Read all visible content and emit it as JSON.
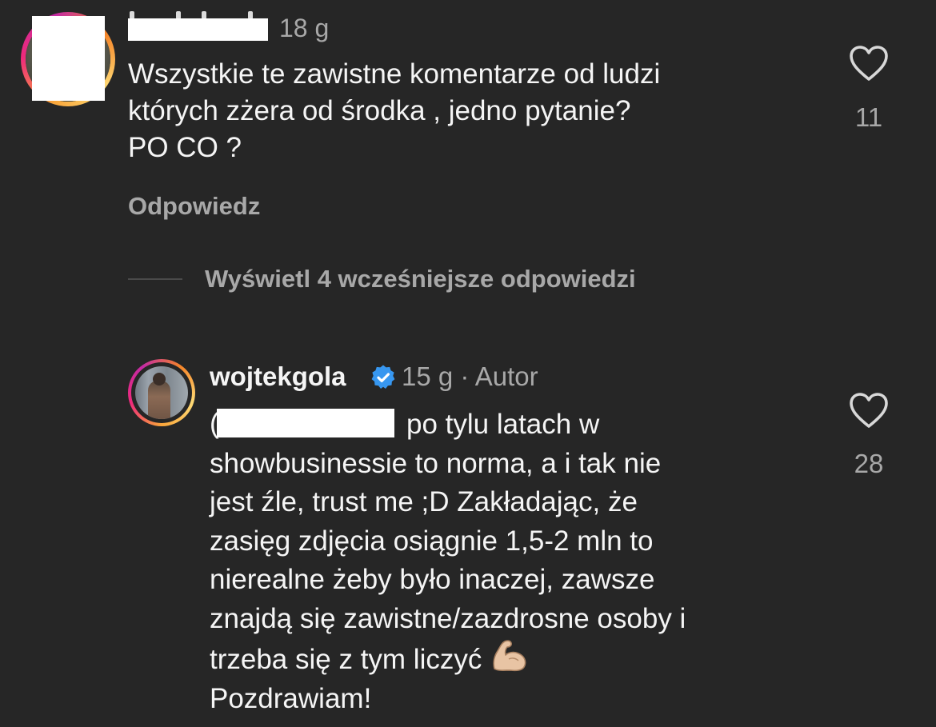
{
  "comment": {
    "time": "18 g",
    "lines": [
      "Wszystkie te zawistne komentarze od ludzi",
      "których zżera od środka , jedno pytanie?",
      "PO CO ?"
    ],
    "reply_label": "Odpowiedz",
    "like_count": "11"
  },
  "thread": {
    "view_more_label": "Wyświetl 4 wcześniejsze odpowiedzi"
  },
  "reply": {
    "username": "wojtekgola",
    "time_author": "15 g · Autor",
    "mention_visible_char": "(",
    "lines": [
      "po tylu latach w",
      "showbusinessie to norma, a i tak nie",
      "jest źle, trust me ;D Zakładając, że",
      "zasięg zdjęcia osiągnie 1,5-2 mln to",
      "nierealne żeby było inaczej, zawsze",
      "znajdą się zawistne/zazdrosne osoby i",
      "trzeba się z tym liczyć",
      "Pozdrawiam!"
    ],
    "like_count": "28"
  },
  "icons": {
    "like": "heart-outline-icon",
    "verified": "verified-badge-icon",
    "emoji": "flexed-biceps-emoji"
  },
  "colors": {
    "background": "#262626",
    "text_primary": "#f5f5f5",
    "text_secondary": "#a8a8a8",
    "verified_blue": "#3797f0"
  }
}
